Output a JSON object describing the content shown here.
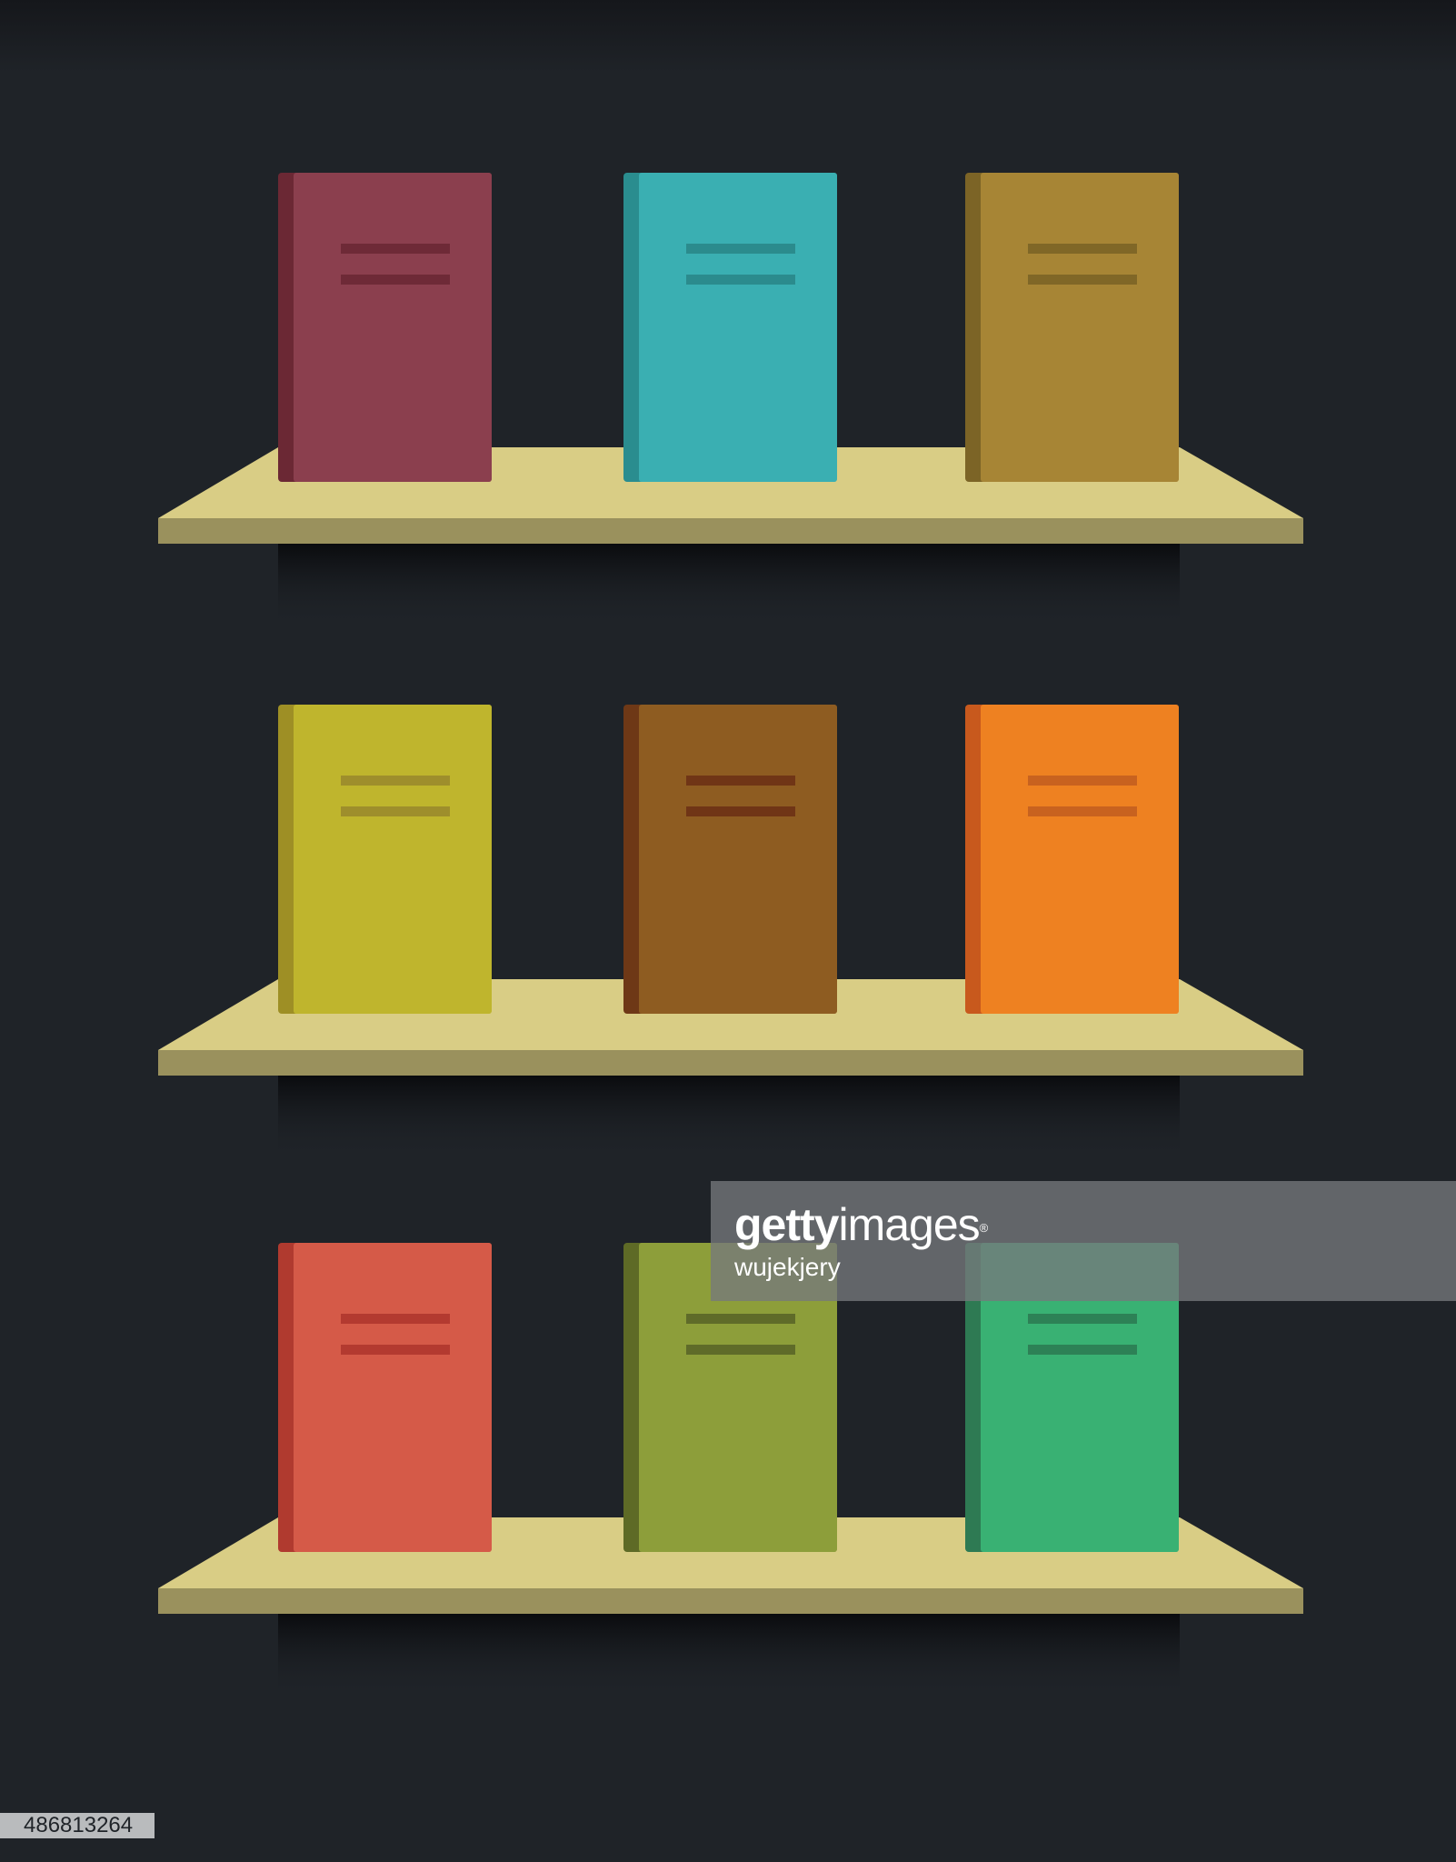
{
  "colors": {
    "background": "#1f2328",
    "shelf_top": "#d9cd85",
    "shelf_front": "#9a915d",
    "shelf_shadow": "#0e0f12"
  },
  "shelves": [
    {
      "books": [
        {
          "cover": "#8b3f4e",
          "spine": "#6b2834",
          "lines": "#6e2a37"
        },
        {
          "cover": "#3aafb2",
          "spine": "#2a8d8f",
          "lines": "#2b8b8d"
        },
        {
          "cover": "#a78535",
          "spine": "#7c6426",
          "lines": "#806727"
        }
      ]
    },
    {
      "books": [
        {
          "cover": "#bfb52d",
          "spine": "#9e8f25",
          "lines": "#9e8e2c"
        },
        {
          "cover": "#8e5c21",
          "spine": "#6e3816",
          "lines": "#703516"
        },
        {
          "cover": "#ee8121",
          "spine": "#c8591d",
          "lines": "#c8621f"
        }
      ]
    },
    {
      "books": [
        {
          "cover": "#d55a48",
          "spine": "#b03a2f",
          "lines": "#b33a30"
        },
        {
          "cover": "#8d9e3a",
          "spine": "#5e6a26",
          "lines": "#5f6b29"
        },
        {
          "cover": "#39b173",
          "spine": "#2e7a53",
          "lines": "#2d8156"
        }
      ]
    }
  ],
  "watermark": {
    "brand_bold": "getty",
    "brand_regular": "images",
    "registered_mark": "®",
    "contributor": "wujekjery"
  },
  "image_id": "486813264"
}
